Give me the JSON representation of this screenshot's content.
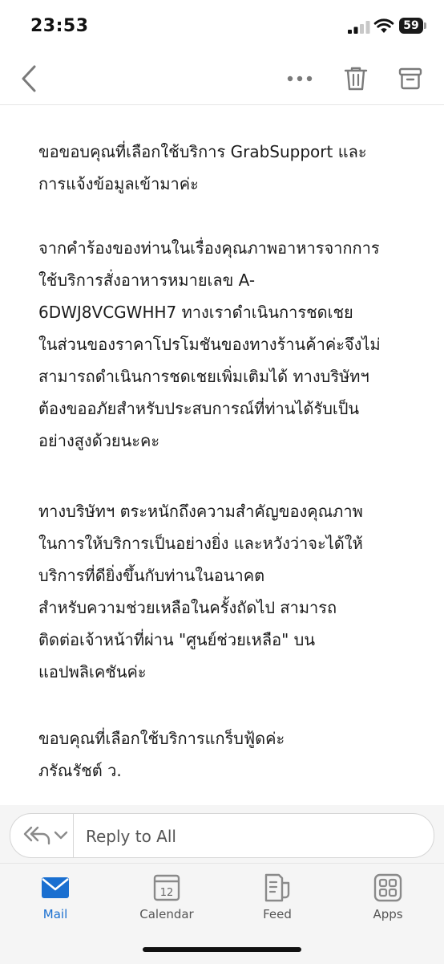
{
  "status_bar": {
    "time": "23:53",
    "battery": "59"
  },
  "email": {
    "paragraphs": [
      "ขอขอบคุณที่เลือกใช้บริการ GrabSupport และ\nการแจ้งข้อมูลเข้ามาค่ะ",
      "จากคำร้องของท่านในเรื่องคุณภาพอาหารจากการ\nใช้บริการสั่งอาหารหมายเลข A-\n6DWJ8VCGWHH7 ทางเราดำเนินการชดเชย\nในส่วนของราคาโปรโมชันของทางร้านค้าค่ะจึงไม่\nสามารถดำเนินการชดเชยเพิ่มเติมได้ ทางบริษัทฯ\nต้องขออภัยสำหรับประสบการณ์ที่ท่านได้รับเป็น\nอย่างสูงด้วยนะคะ",
      "ทางบริษัทฯ ตระหนักถึงความสำคัญของคุณภาพ\nในการให้บริการเป็นอย่างยิ่ง และหวังว่าจะได้ให้\nบริการที่ดียิ่งขึ้นกับท่านในอนาคต\nสำหรับความช่วยเหลือในครั้งถัดไป สามารถ\nติดต่อเจ้าหน้าที่ผ่าน \"ศูนย์ช่วยเหลือ\" บน\nแอปพลิเคชันค่ะ",
      "ขอบคุณที่เลือกใช้บริการแกร็บฟู้ดค่ะ\nภรัณรัชต์ ว."
    ]
  },
  "reply": {
    "placeholder": "Reply to All"
  },
  "tabs": [
    {
      "label": "Mail",
      "icon": "mail-icon"
    },
    {
      "label": "Calendar",
      "icon": "calendar-icon",
      "day": "12"
    },
    {
      "label": "Feed",
      "icon": "feed-icon"
    },
    {
      "label": "Apps",
      "icon": "apps-icon"
    }
  ],
  "colors": {
    "accent": "#1a6fd0",
    "icon_gray": "#8a8a8a"
  }
}
